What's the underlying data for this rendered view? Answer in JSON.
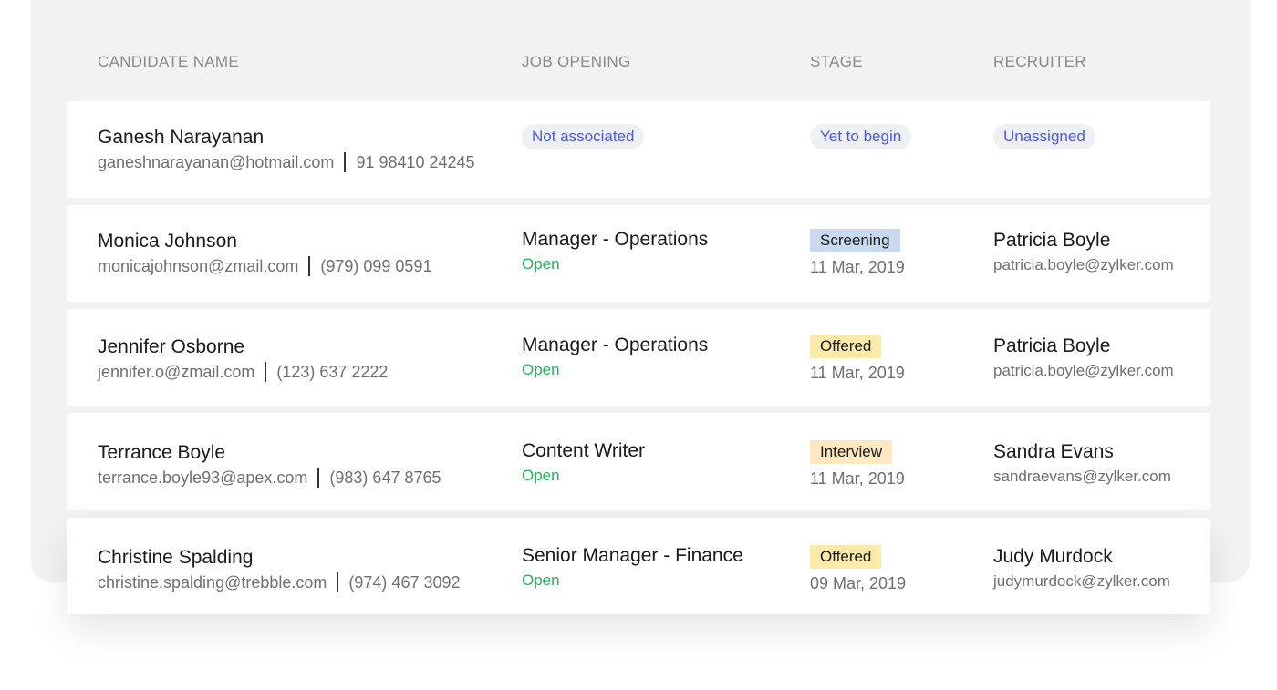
{
  "columns": {
    "candidate": "CANDIDATE NAME",
    "job": "JOB OPENING",
    "stage": "STAGE",
    "recruiter": "RECRUITER"
  },
  "rows": [
    {
      "name": "Ganesh Narayanan",
      "email": "ganeshnarayanan@hotmail.com",
      "phone": "91 98410 24245",
      "job_pill": "Not associated",
      "stage_pill": "Yet to begin",
      "recruiter_pill": "Unassigned"
    },
    {
      "name": "Monica Johnson",
      "email": "monicajohnson@zmail.com",
      "phone": "(979) 099 0591",
      "job_title": "Manager - Operations",
      "job_status": "Open",
      "stage": "Screening",
      "stage_color": "#c9daf0",
      "stage_date": "11 Mar, 2019",
      "recruiter_name": "Patricia Boyle",
      "recruiter_email": "patricia.boyle@zylker.com"
    },
    {
      "name": "Jennifer Osborne",
      "email": "jennifer.o@zmail.com",
      "phone": "(123) 637 2222",
      "job_title": "Manager - Operations",
      "job_status": "Open",
      "stage": "Offered",
      "stage_color": "#fbeaa8",
      "stage_date": "11 Mar, 2019",
      "recruiter_name": "Patricia Boyle",
      "recruiter_email": "patricia.boyle@zylker.com"
    },
    {
      "name": "Terrance Boyle",
      "email": "terrance.boyle93@apex.com",
      "phone": "(983) 647 8765",
      "job_title": "Content Writer",
      "job_status": "Open",
      "stage": "Interview",
      "stage_color": "#fde8c2",
      "stage_date": "11 Mar, 2019",
      "recruiter_name": "Sandra Evans",
      "recruiter_email": "sandraevans@zylker.com"
    },
    {
      "name": "Christine Spalding",
      "email": "christine.spalding@trebble.com",
      "phone": "(974) 467 3092",
      "job_title": "Senior Manager - Finance",
      "job_status": "Open",
      "stage": "Offered",
      "stage_color": "#fbeaa8",
      "stage_date": "09 Mar, 2019",
      "recruiter_name": "Judy Murdock",
      "recruiter_email": "judymurdock@zylker.com"
    }
  ],
  "colors": {
    "open_status": "#22b35a",
    "pill_text": "#4a5cd6",
    "pill_bg": "#eef0f4"
  }
}
